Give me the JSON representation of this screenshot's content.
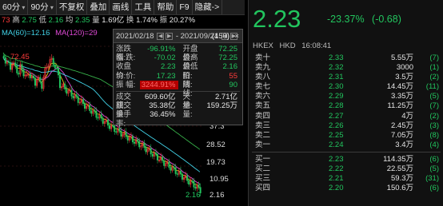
{
  "toolbar": {
    "items": [
      "60分",
      "90分",
      "不复权",
      "叠加",
      "画线",
      "工具",
      "帮助",
      "F9",
      "隐藏->"
    ]
  },
  "infobar": {
    "high_label": "高",
    "high": "2.75",
    "low_label": "低",
    "low": "2.16",
    "avg_label": "均",
    "avg": "2.35",
    "vol_label": "量",
    "vol": "1.69亿",
    "turnover_label": "换",
    "turnover": "1.74%",
    "amp_label": "振",
    "amp": "20.27%",
    "leading": "73"
  },
  "ma": {
    "ma60": "MA(60)=12.16",
    "ma120": "MA(120)=29"
  },
  "axis": {
    "high_mark": "72.45",
    "ticks": [
      "37.3",
      "28.52",
      "19.73",
      "10.95",
      "2.16"
    ],
    "low_mark": "2.16"
  },
  "popup": {
    "date_from": "2021/02/18",
    "date_sep": "-",
    "date_to": "2021/09/24",
    "count": "(150)",
    "close": "×",
    "rows": [
      {
        "l1": "涨跌幅:",
        "v1": "-96.91%",
        "c1": "green",
        "l2": "开盘价:",
        "v2": "72.25",
        "c2": "green"
      },
      {
        "l1": "涨  跌:",
        "v1": "-70.02",
        "c1": "green",
        "l2": "最高价:",
        "v2": "72.25",
        "c2": "green"
      },
      {
        "l1": "收盘价:",
        "v1": "2.23",
        "c1": "green",
        "l2": "最低价:",
        "v2": "2.16",
        "c2": "green"
      },
      {
        "l1": "均  价:",
        "v1": "17.23",
        "c1": "green",
        "l2": "阳  线:",
        "v2": "55",
        "c2": "red"
      },
      {
        "l1": "振  幅:",
        "v1": "3244.91%",
        "c1": "redbg",
        "l2": "阴  线:",
        "v2": "90",
        "c2": "green"
      }
    ],
    "rows2": [
      {
        "l1": "成交额:",
        "v1": "609.60亿",
        "l2": "天  量:",
        "v2": "2.71亿"
      },
      {
        "l1": "成交量:",
        "v1": "35.38亿",
        "l2": "地  量:",
        "v2": "159.25万"
      },
      {
        "l1": "换手率:",
        "v1": "36.45%",
        "l2": "",
        "v2": ""
      }
    ]
  },
  "quote": {
    "price": "2.23",
    "change_pct": "-23.37%",
    "change": "(-0.68)",
    "exchange": "HKEX",
    "currency": "HKD",
    "time": "16:08:41"
  },
  "asks": [
    {
      "name": "卖十",
      "price": "2.33",
      "vol": "5.55万",
      "orders": "(7)"
    },
    {
      "name": "卖九",
      "price": "2.32",
      "vol": "3000",
      "orders": "(1)"
    },
    {
      "name": "卖八",
      "price": "2.31",
      "vol": "3.5万",
      "orders": "(2)"
    },
    {
      "name": "卖七",
      "price": "2.30",
      "vol": "14.45万",
      "orders": "(11)"
    },
    {
      "name": "卖六",
      "price": "2.29",
      "vol": "3.35万",
      "orders": "(5)"
    },
    {
      "name": "卖五",
      "price": "2.28",
      "vol": "11.25万",
      "orders": "(7)"
    },
    {
      "name": "卖四",
      "price": "2.27",
      "vol": "4万",
      "orders": "(2)"
    },
    {
      "name": "卖三",
      "price": "2.26",
      "vol": "2.45万",
      "orders": "(3)"
    },
    {
      "name": "卖二",
      "price": "2.25",
      "vol": "7.05万",
      "orders": "(8)"
    },
    {
      "name": "卖一",
      "price": "2.24",
      "vol": "3.4万",
      "orders": "(4)"
    }
  ],
  "bids": [
    {
      "name": "买一",
      "price": "2.23",
      "vol": "114.35万",
      "orders": "(6)"
    },
    {
      "name": "买二",
      "price": "2.22",
      "vol": "22.55万",
      "orders": "(5)"
    },
    {
      "name": "买三",
      "price": "2.21",
      "vol": "59.3万",
      "orders": "(31)"
    },
    {
      "name": "买四",
      "price": "2.20",
      "vol": "150.6万",
      "orders": "(6)"
    }
  ],
  "colors": {
    "up": "#ff3b3b",
    "down": "#22c55e",
    "ma_yellow": "#e6c619",
    "ma_cyan": "#41d1e6",
    "ma_magenta": "#e04ad7",
    "ma_green": "#38b24a",
    "bg_selected": "#3a0000"
  }
}
